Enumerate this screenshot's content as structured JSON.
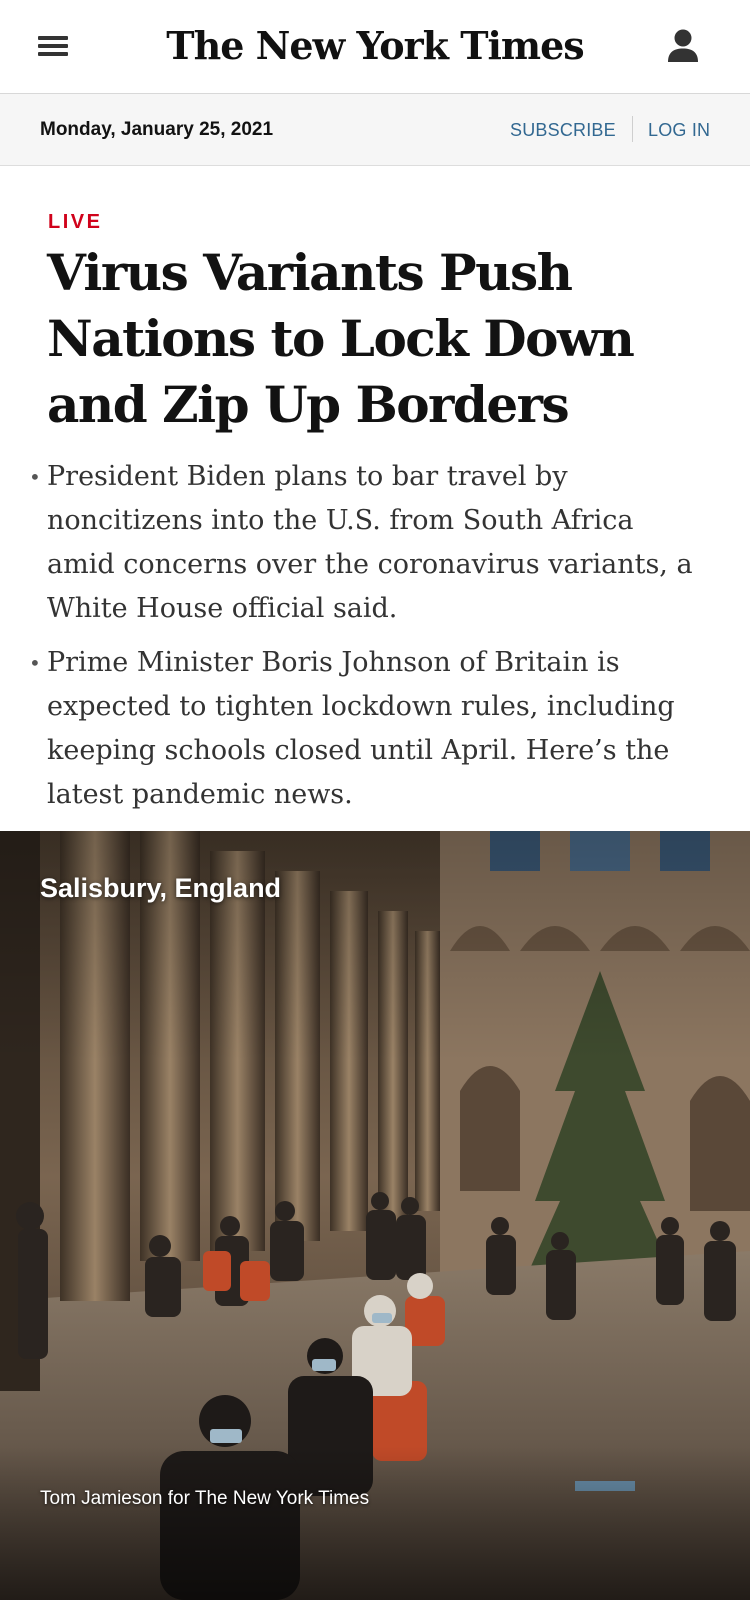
{
  "header": {
    "menu_icon": "hamburger-menu-icon",
    "logo_text": "The New York Times",
    "account_icon": "user-account-icon"
  },
  "datebar": {
    "date": "Monday, January 25, 2021",
    "subscribe_label": "SUBSCRIBE",
    "login_label": "LOG IN"
  },
  "story": {
    "label": "LIVE",
    "headline": "Virus Variants Push Nations to Lock Down and Zip Up Borders",
    "summary": [
      "President Biden plans to bar travel by noncitizens into the U.S. from South Africa amid concerns over the coronavirus variants, a White House official said.",
      "Prime Minister Boris Johnson of Britain is expected to tighten lockdown rules, including keeping schools closed until April. Here’s the latest pandemic news."
    ],
    "bullet_char": "•"
  },
  "photo": {
    "dateline": "Salisbury, England",
    "credit": "Tom Jamieson for The New York Times"
  },
  "colors": {
    "live_red": "#d0021b",
    "link_blue": "#326891",
    "datebar_bg": "#f6f6f6"
  }
}
